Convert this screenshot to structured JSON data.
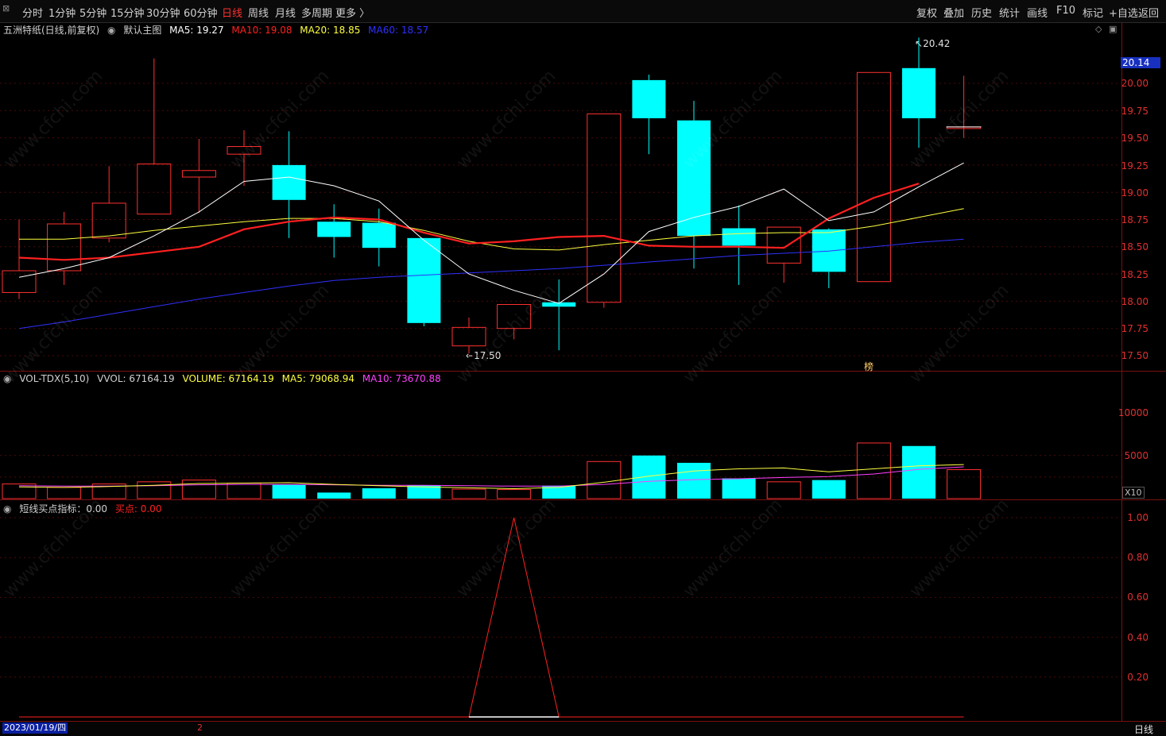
{
  "toolbar": {
    "periods": [
      "分时",
      "1分钟",
      "5分钟",
      "15分钟",
      "30分钟",
      "60分钟",
      "日线",
      "周线",
      "月线",
      "多周期",
      "更多 〉"
    ],
    "active_period": "日线",
    "actions": [
      "复权",
      "叠加",
      "历史",
      "统计",
      "画线",
      "F10",
      "标记",
      "+自选",
      "返回"
    ]
  },
  "main_panel": {
    "title": "五洲特纸(日线,前复权)",
    "template": "默认主图",
    "ma5": {
      "label": "MA5: 19.27",
      "color": "#ffffff"
    },
    "ma10": {
      "label": "MA10: 19.08",
      "color": "#ff2020"
    },
    "ma20": {
      "label": "MA20: 18.85",
      "color": "#ffff40"
    },
    "ma60": {
      "label": "MA60: 18.57",
      "color": "#3030ff"
    },
    "high_annotation": "20.42",
    "low_annotation": "17.50",
    "current_price_tag": "20.14",
    "bang_mark": "榜",
    "y_ticks": [
      "20.00",
      "19.75",
      "19.50",
      "19.25",
      "19.00",
      "18.75",
      "18.50",
      "18.25",
      "18.00",
      "17.75",
      "17.50"
    ]
  },
  "volume_panel": {
    "name": "VOL-TDX(5,10)",
    "vvol": "VVOL: 67164.19",
    "volume": {
      "label": "VOLUME: 67164.19",
      "color": "#ffff40"
    },
    "ma5": {
      "label": "MA5: 79068.94",
      "color": "#ffff40"
    },
    "ma10": {
      "label": "MA10: 73670.88",
      "color": "#ff40ff"
    },
    "y_ticks": [
      "10000",
      "5000"
    ],
    "multiplier": "X10"
  },
  "indicator_panel": {
    "name": "短线买点指标：0.00",
    "buy": {
      "label": "买点: 0.00",
      "color": "#ff2020"
    },
    "y_ticks": [
      "1.00",
      "0.80",
      "0.60",
      "0.40",
      "0.20"
    ]
  },
  "footer": {
    "date": "2023/01/19/四",
    "page": "2",
    "period_tab": "日线"
  },
  "watermark": "www.cfchi.com",
  "colors": {
    "up": "#ff3030",
    "down": "#00ffff",
    "background": "#000000"
  },
  "chart_data": {
    "type": "candlestick",
    "price_range": [
      17.4,
      20.6
    ],
    "candles": [
      {
        "open": 18.08,
        "close": 18.28,
        "high": 18.75,
        "low": 18.02
      },
      {
        "open": 18.28,
        "close": 18.71,
        "high": 18.82,
        "low": 18.15
      },
      {
        "open": 18.58,
        "close": 18.9,
        "high": 19.24,
        "low": 18.54
      },
      {
        "open": 18.8,
        "close": 19.26,
        "high": 20.23,
        "low": 18.8
      },
      {
        "open": 19.14,
        "close": 19.2,
        "high": 19.49,
        "low": 18.81
      },
      {
        "open": 19.35,
        "close": 19.42,
        "high": 19.57,
        "low": 19.06
      },
      {
        "open": 19.25,
        "close": 18.93,
        "high": 19.56,
        "low": 18.58
      },
      {
        "open": 18.73,
        "close": 18.59,
        "high": 18.89,
        "low": 18.4
      },
      {
        "open": 18.72,
        "close": 18.49,
        "high": 18.85,
        "low": 18.32
      },
      {
        "open": 18.58,
        "close": 17.8,
        "high": 18.58,
        "low": 17.77
      },
      {
        "open": 17.59,
        "close": 17.76,
        "high": 17.85,
        "low": 17.52
      },
      {
        "open": 17.75,
        "close": 17.97,
        "high": 17.97,
        "low": 17.65
      },
      {
        "open": 17.99,
        "close": 17.95,
        "high": 18.2,
        "low": 17.55
      },
      {
        "open": 17.99,
        "close": 19.72,
        "high": 19.72,
        "low": 17.94
      },
      {
        "open": 20.03,
        "close": 19.68,
        "high": 20.08,
        "low": 19.35
      },
      {
        "open": 19.66,
        "close": 18.6,
        "high": 19.84,
        "low": 18.3
      },
      {
        "open": 18.67,
        "close": 18.51,
        "high": 18.88,
        "low": 18.15
      },
      {
        "open": 18.35,
        "close": 18.68,
        "high": 18.68,
        "low": 18.17
      },
      {
        "open": 18.66,
        "close": 18.27,
        "high": 18.67,
        "low": 18.12
      },
      {
        "open": 18.18,
        "close": 20.1,
        "high": 20.1,
        "low": 18.18
      },
      {
        "open": 20.14,
        "close": 19.68,
        "high": 20.42,
        "low": 19.41
      },
      {
        "open": 19.6,
        "close": 19.6,
        "high": 20.07,
        "low": 19.5
      }
    ],
    "ma5": [
      18.22,
      18.3,
      18.4,
      18.6,
      18.82,
      19.1,
      19.14,
      19.06,
      18.92,
      18.56,
      18.25,
      18.1,
      17.98,
      18.25,
      18.64,
      18.77,
      18.87,
      19.03,
      18.74,
      18.82,
      19.05,
      19.27
    ],
    "ma10": [
      18.4,
      18.38,
      18.4,
      18.45,
      18.5,
      18.66,
      18.73,
      18.77,
      18.75,
      18.63,
      18.53,
      18.55,
      18.59,
      18.6,
      18.51,
      18.5,
      18.5,
      18.49,
      18.76,
      18.95,
      19.08
    ],
    "ma20": [
      18.57,
      18.57,
      18.6,
      18.65,
      18.69,
      18.73,
      18.76,
      18.76,
      18.73,
      18.65,
      18.55,
      18.48,
      18.47,
      18.52,
      18.56,
      18.6,
      18.62,
      18.63,
      18.63,
      18.69,
      18.77,
      18.85
    ],
    "ma60": [
      17.75,
      17.81,
      17.88,
      17.95,
      18.02,
      18.08,
      18.14,
      18.19,
      18.22,
      18.24,
      18.26,
      18.28,
      18.3,
      18.33,
      18.36,
      18.39,
      18.42,
      18.44,
      18.46,
      18.5,
      18.54,
      18.57
    ],
    "volume": [
      34000,
      26000,
      34000,
      39000,
      43000,
      36000,
      32000,
      14000,
      24000,
      31000,
      22000,
      21000,
      30000,
      86000,
      100000,
      83000,
      47000,
      39000,
      43000,
      129000,
      122000,
      67164
    ],
    "vol_ma5": [
      27000,
      26000,
      28000,
      31000,
      35000,
      36000,
      37000,
      33000,
      30000,
      27000,
      25000,
      23000,
      26000,
      38000,
      52000,
      64000,
      69000,
      71000,
      62000,
      69000,
      76000,
      79069
    ],
    "vol_ma10": [
      30000,
      29000,
      29000,
      30000,
      32000,
      33000,
      33000,
      32000,
      31000,
      31000,
      30000,
      29000,
      29000,
      33000,
      40000,
      44000,
      46000,
      49000,
      51000,
      57000,
      68000,
      73671
    ],
    "volume_range": [
      0,
      133000
    ],
    "indicator": [
      0,
      0,
      0,
      0,
      0,
      0,
      0,
      0,
      0,
      0,
      0,
      1,
      0,
      0,
      0,
      0,
      0,
      0,
      0,
      0,
      0,
      0
    ],
    "indicator_range": [
      0,
      1
    ]
  }
}
